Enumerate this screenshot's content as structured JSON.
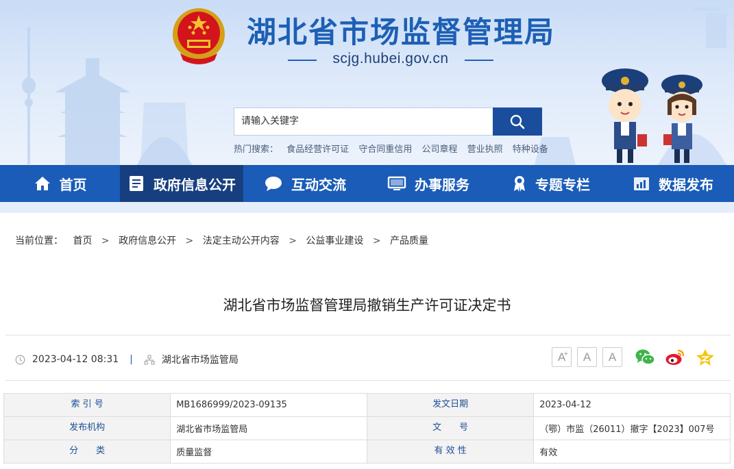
{
  "header": {
    "site_title": "湖北省市场监督管理局",
    "domain": "scjg.hubei.gov.cn",
    "search_placeholder": "请输入关键字",
    "hot_label": "热门搜索：",
    "hot_keywords": [
      "食品经营许可证",
      "守合同重信用",
      "公司章程",
      "营业执照",
      "特种设备"
    ]
  },
  "nav": [
    {
      "label": "首页",
      "icon": "home-icon"
    },
    {
      "label": "政府信息公开",
      "icon": "document-list-icon",
      "active": true
    },
    {
      "label": "互动交流",
      "icon": "chat-bubble-icon"
    },
    {
      "label": "办事服务",
      "icon": "monitor-icon"
    },
    {
      "label": "专题专栏",
      "icon": "award-ribbon-icon"
    },
    {
      "label": "数据发布",
      "icon": "bar-chart-icon"
    }
  ],
  "breadcrumb": {
    "label": "当前位置：",
    "items": [
      "首页",
      "政府信息公开",
      "法定主动公开内容",
      "公益事业建设",
      "产品质量"
    ]
  },
  "article": {
    "title": "湖北省市场监督管理局撤销生产许可证决定书",
    "datetime": "2023-04-12 08:31",
    "separator": "|",
    "source": "湖北省市场监管局",
    "font_buttons": [
      "A+",
      "A",
      "A"
    ]
  },
  "share": [
    "wechat-icon",
    "weibo-icon",
    "qzone-icon"
  ],
  "info_table": {
    "rows": [
      {
        "k1": "索 引 号",
        "v1": "MB1686999/2023-09135",
        "k2": "发文日期",
        "v2": "2023-04-12"
      },
      {
        "k1": "发布机构",
        "v1": "湖北省市场监管局",
        "k2": "文　　号",
        "v2": "（鄂）市监（26011）撤字【2023】007号"
      },
      {
        "k1": "分　　类",
        "v1": "质量监督",
        "k2": "有 效 性",
        "v2": "有效"
      }
    ]
  },
  "colors": {
    "brand_blue": "#1d5fb5",
    "nav_blue": "#1a5cb8",
    "nav_active": "#173f7f",
    "search_button": "#1a4d9c"
  }
}
